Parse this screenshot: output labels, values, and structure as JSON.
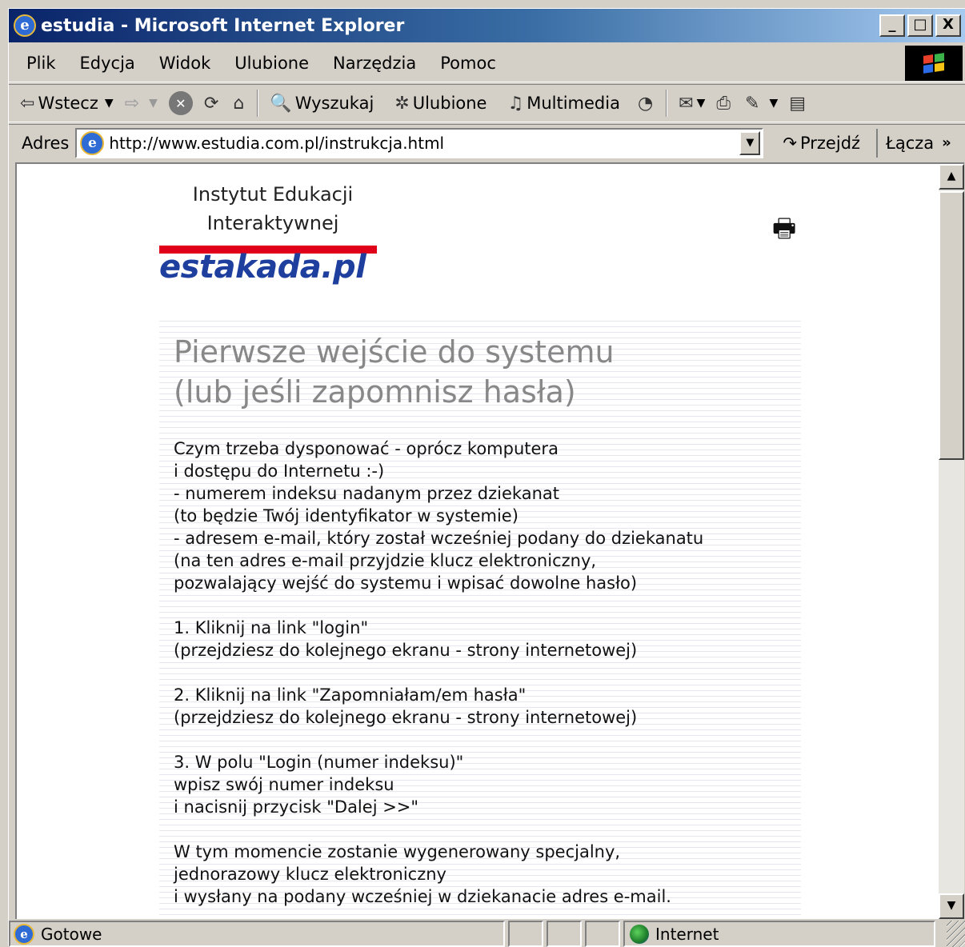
{
  "window": {
    "title": "estudia - Microsoft Internet Explorer",
    "controls": {
      "minimize": "_",
      "maximize": "□",
      "close": "X"
    }
  },
  "menu": [
    "Plik",
    "Edycja",
    "Widok",
    "Ulubione",
    "Narzędzia",
    "Pomoc"
  ],
  "toolbar": {
    "back": "Wstecz",
    "search": "Wyszukaj",
    "favorites": "Ulubione",
    "media": "Multimedia"
  },
  "address": {
    "label": "Adres",
    "url": "http://www.estudia.com.pl/instrukcja.html",
    "go": "Przejdź",
    "links": "Łącza",
    "more": "»"
  },
  "page": {
    "institute": "Instytut Edukacji\nInteraktywnej",
    "logo": "estakada.pl",
    "heading": "Pierwsze wejście do systemu\n(lub jeśli zapomnisz hasła)",
    "lines": [
      "Czym trzeba dysponować - oprócz komputera",
      "i dostępu do Internetu :-)",
      "- numerem indeksu nadanym przez dziekanat",
      "(to będzie Twój identyfikator w systemie)",
      "- adresem e-mail, który został wcześniej podany do dziekanatu",
      "(na ten adres e-mail przyjdzie klucz elektroniczny,",
      "pozwalający wejść do systemu i wpisać dowolne hasło)",
      "",
      "1. Kliknij na link \"login\"",
      "(przejdziesz do kolejnego ekranu - strony internetowej)",
      "",
      "2. Kliknij na link \"Zapomniałam/em hasła\"",
      "(przejdziesz do kolejnego ekranu - strony internetowej)",
      "",
      "3. W polu \"Login (numer indeksu)\"",
      "wpisz swój numer indeksu",
      "i nacisnij przycisk \"Dalej >>\"",
      "",
      "W tym momencie zostanie wygenerowany specjalny,",
      "jednorazowy klucz elektroniczny",
      "i wysłany na podany wcześniej w dziekanacie adres e-mail."
    ]
  },
  "status": {
    "text": "Gotowe",
    "zone": "Internet"
  }
}
